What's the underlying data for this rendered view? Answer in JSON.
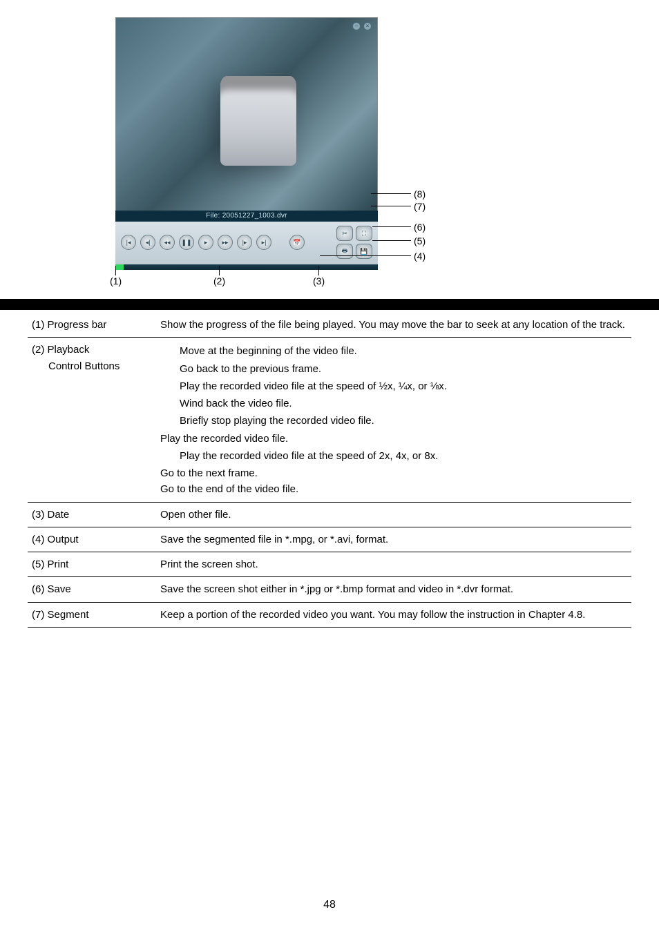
{
  "figure": {
    "file_bar": "File: 20051227_1003.dvr",
    "labels_right": {
      "n8": "(8)",
      "n7": "(7)",
      "n6": "(6)",
      "n5": "(5)",
      "n4": "(4)"
    },
    "labels_bottom": {
      "n1": "(1)",
      "n2": "(2)",
      "n3": "(3)"
    }
  },
  "rows": {
    "r1": {
      "key": "(1) Progress bar",
      "body": "Show the progress of the file being played. You may move the bar to seek at any location of the track."
    },
    "r2": {
      "key1": "(2) Playback",
      "key2": "Control Buttons",
      "items": [
        "Move at the beginning of the video file.",
        "Go back to the previous frame.",
        "Play the recorded video file at the speed of ½x, ¼x, or ⅛x.",
        "Wind back the video file.",
        "Briefly stop playing the recorded video file.",
        "Play the recorded video file.",
        "Play the recorded video file at the speed of 2x, 4x, or 8x.",
        "Go to the next frame.",
        "Go to the end of the video file."
      ]
    },
    "r3": {
      "key": "(3) Date",
      "body": "Open other file."
    },
    "r4": {
      "key": "(4) Output",
      "body": "Save the segmented file in *.mpg, or *.avi, format."
    },
    "r5": {
      "key": "(5) Print",
      "body": "Print the screen shot."
    },
    "r6": {
      "key": "(6) Save",
      "body": "Save the screen shot either in *.jpg or *.bmp format and video in *.dvr format."
    },
    "r7": {
      "key": "(7) Segment",
      "body": "Keep a portion of the recorded video you want. You may follow the instruction in Chapter 4.8."
    }
  },
  "page": "48"
}
